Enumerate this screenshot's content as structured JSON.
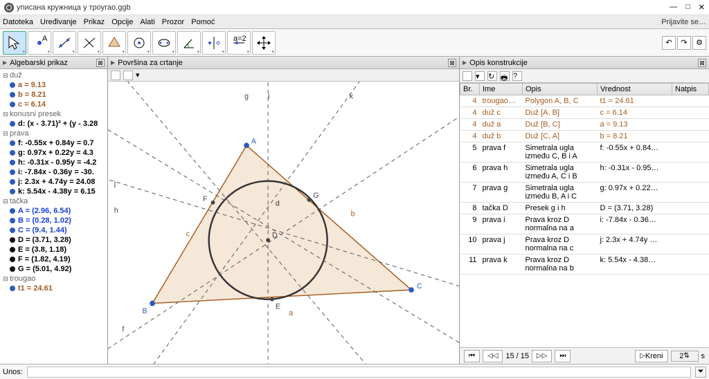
{
  "window": {
    "title": "уписана кружница у троугао.ggb",
    "signin": "Prijavite se…"
  },
  "menu": {
    "items": [
      "Datoteka",
      "Uređivanje",
      "Prikaz",
      "Opcije",
      "Alati",
      "Prozor",
      "Pomoć"
    ]
  },
  "panels": {
    "algebra": "Algebarski prikaz",
    "graphics": "Površina za crtanje",
    "protocol": "Opis konstrukcije"
  },
  "algebra": {
    "groups": [
      {
        "label": "duž",
        "items": [
          {
            "text": "a = 9.13",
            "color": "brown",
            "dot": "blue"
          },
          {
            "text": "b = 8.21",
            "color": "brown",
            "dot": "blue"
          },
          {
            "text": "c = 6.14",
            "color": "brown",
            "dot": "blue"
          }
        ]
      },
      {
        "label": "konusni presek",
        "items": [
          {
            "text": "d: (x - 3.71)² + (y - 3.28",
            "color": "black",
            "dot": "blue",
            "bold": true
          }
        ]
      },
      {
        "label": "prava",
        "items": [
          {
            "text": "f: -0.55x + 0.84y = 0.7",
            "color": "black",
            "dot": "blue"
          },
          {
            "text": "g: 0.97x + 0.22y = 4.3",
            "color": "black",
            "dot": "blue"
          },
          {
            "text": "h: -0.31x - 0.95y = -4.2",
            "color": "black",
            "dot": "blue"
          },
          {
            "text": "i: -7.84x - 0.36y = -30.",
            "color": "black",
            "dot": "blue"
          },
          {
            "text": "j: 2.3x + 4.74y = 24.08",
            "color": "black",
            "dot": "blue"
          },
          {
            "text": "k: 5.54x - 4.38y = 6.15",
            "color": "black",
            "dot": "blue"
          }
        ]
      },
      {
        "label": "tačka",
        "items": [
          {
            "text": "A = (2.96, 6.54)",
            "color": "blue",
            "dot": "blue"
          },
          {
            "text": "B = (0.28, 1.02)",
            "color": "blue",
            "dot": "blue"
          },
          {
            "text": "C = (9.4, 1.44)",
            "color": "blue",
            "dot": "blue"
          },
          {
            "text": "D = (3.71, 3.28)",
            "color": "black",
            "dot": "black"
          },
          {
            "text": "E = (3.8, 1.18)",
            "color": "black",
            "dot": "black"
          },
          {
            "text": "F = (1.82, 4.19)",
            "color": "black",
            "dot": "black"
          },
          {
            "text": "G = (5.01, 4.92)",
            "color": "black",
            "dot": "black"
          }
        ]
      },
      {
        "label": "trougao",
        "items": [
          {
            "text": "t1 = 24.61",
            "color": "brown",
            "dot": "blue"
          }
        ]
      }
    ]
  },
  "graphics_labels": {
    "A": "A",
    "B": "B",
    "C": "C",
    "D": "D",
    "E": "E",
    "F": "F",
    "G": "G",
    "a": "a",
    "b": "b",
    "c": "c",
    "d": "d",
    "f": "f",
    "g": "g",
    "h": "h",
    "i": "i",
    "j": "j",
    "k": "k"
  },
  "protocol": {
    "columns": {
      "br": "Br.",
      "ime": "Ime",
      "opis": "Opis",
      "vrednost": "Vrednost",
      "natpis": "Natpis"
    },
    "rows": [
      {
        "n": 4,
        "name": "trougao…",
        "desc": "Polygon A, B, C",
        "val": "t1 = 24.61",
        "cls": "brown"
      },
      {
        "n": 4,
        "name": "duž c",
        "desc": "Duž [A, B]",
        "val": "c = 6.14",
        "cls": "brown"
      },
      {
        "n": 4,
        "name": "duž a",
        "desc": "Duž [B, C]",
        "val": "a = 9.13",
        "cls": "brown"
      },
      {
        "n": 4,
        "name": "duž b",
        "desc": "Duž [C, A]",
        "val": "b = 8.21",
        "cls": "brown"
      },
      {
        "n": 5,
        "name": "prava f",
        "desc": "Simetrala ugla između C, B i A",
        "val": "f: -0.55x + 0.84…",
        "cls": "black"
      },
      {
        "n": 6,
        "name": "prava h",
        "desc": "Simetrala ugla između A, C i B",
        "val": "h: -0.31x - 0.95…",
        "cls": "black"
      },
      {
        "n": 7,
        "name": "prava g",
        "desc": "Simetrala ugla između B, A i C",
        "val": "g: 0.97x + 0.22…",
        "cls": "black"
      },
      {
        "n": 8,
        "name": "tačka D",
        "desc": "Presek g i h",
        "val": "D = (3.71, 3.28)",
        "cls": "black"
      },
      {
        "n": 9,
        "name": "prava i",
        "desc": "Prava kroz D normalna na a",
        "val": "i: -7.84x - 0.36…",
        "cls": "black"
      },
      {
        "n": 10,
        "name": "prava j",
        "desc": "Prava kroz D normalna na c",
        "val": "j: 2.3x + 4.74y …",
        "cls": "black"
      },
      {
        "n": 11,
        "name": "prava k",
        "desc": "Prava kroz D normalna na b",
        "val": "k: 5.54x - 4.38…",
        "cls": "black"
      }
    ],
    "nav": {
      "pos": "15 / 15",
      "play": "Kreni",
      "interval": "2",
      "sec": "s"
    }
  },
  "input": {
    "label": "Unos:"
  }
}
